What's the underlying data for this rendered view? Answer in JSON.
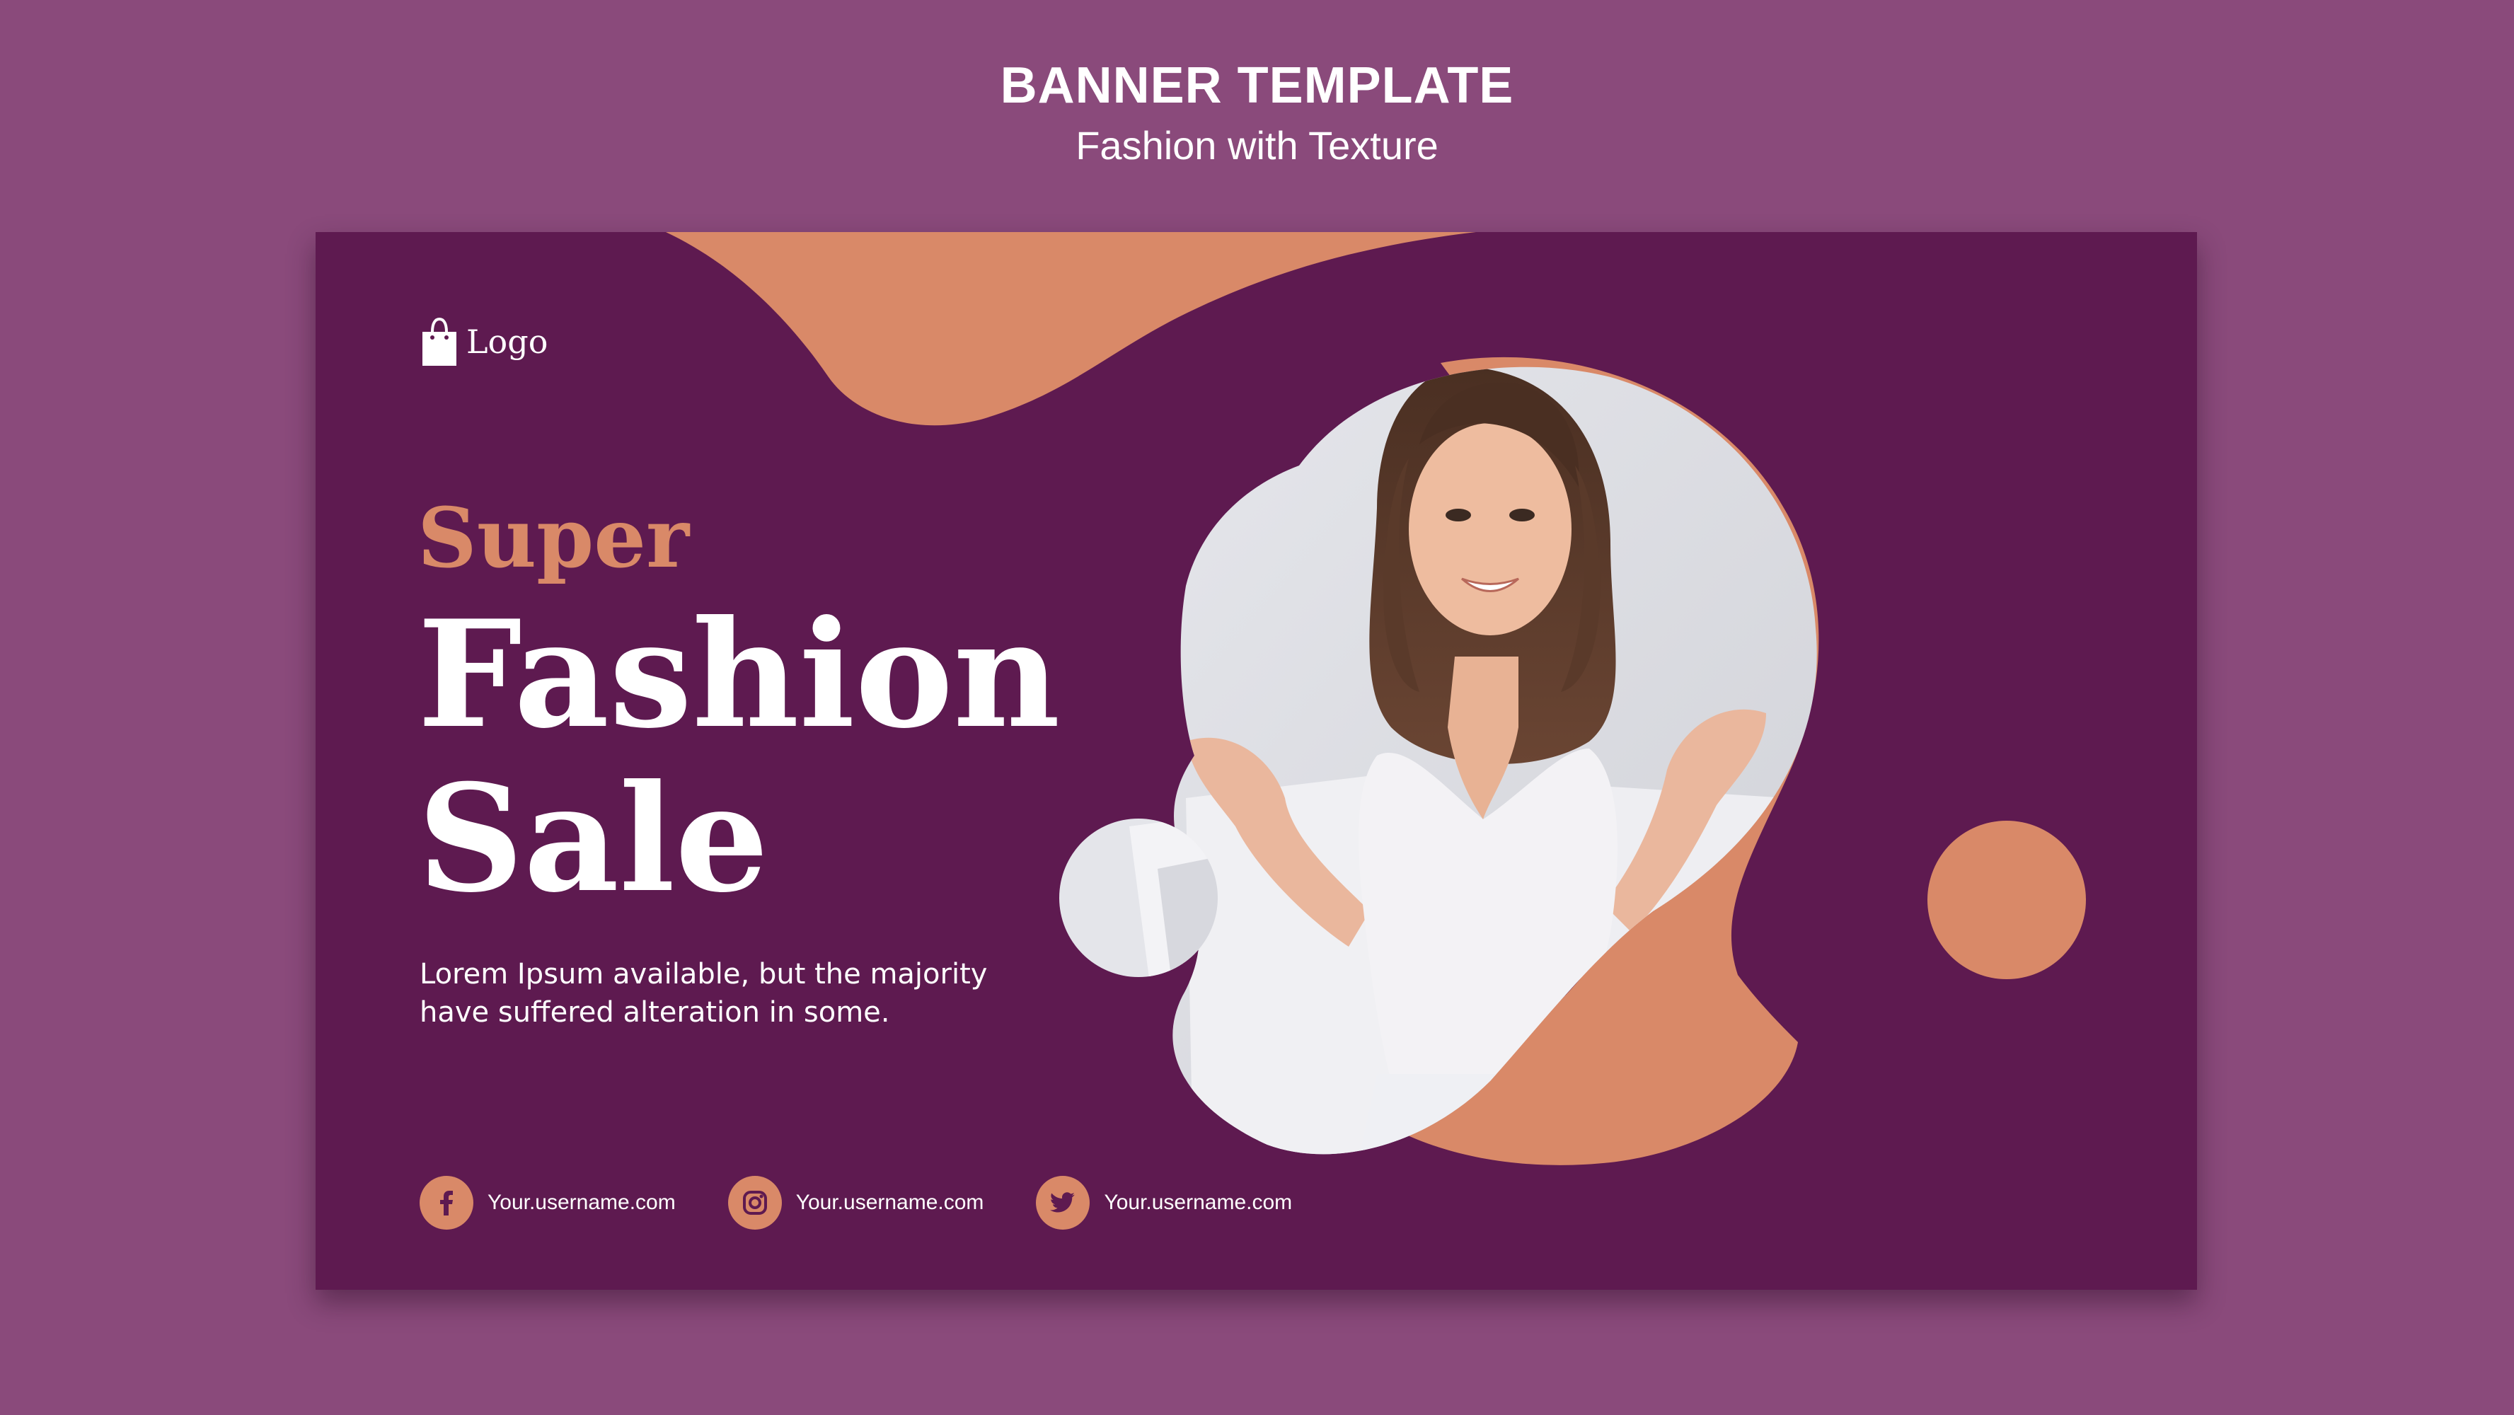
{
  "page_header": {
    "title": "BANNER TEMPLATE",
    "subtitle": "Fashion with Texture"
  },
  "banner": {
    "logo": {
      "icon": "shopping-bag-icon",
      "text": "Logo"
    },
    "headline": {
      "kicker": "Super",
      "line1": "Fashion",
      "line2": "Sale"
    },
    "body": {
      "line1": "Lorem Ipsum available, but the majority",
      "line2": "have suffered alteration in some."
    },
    "photo": {
      "subject": "smiling woman in white top holding shopping bags"
    },
    "social": [
      {
        "network": "facebook",
        "icon": "facebook-icon",
        "handle": "Your.username.com"
      },
      {
        "network": "instagram",
        "icon": "instagram-icon",
        "handle": "Your.username.com"
      },
      {
        "network": "twitter",
        "icon": "twitter-icon",
        "handle": "Your.username.com"
      }
    ]
  },
  "colors": {
    "page_background": "#8a4a7b",
    "banner_background": "#5e1a50",
    "accent_peach": "#d98968",
    "text_light": "#ffffff",
    "photo_background": "#dcdde2"
  }
}
